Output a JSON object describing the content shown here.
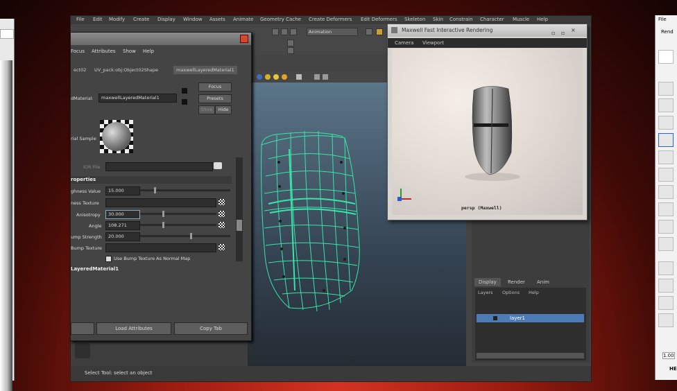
{
  "maya_menu": [
    "File",
    "Edit",
    "Modify",
    "Create",
    "Display",
    "Window",
    "Assets",
    "Animate",
    "Geometry Cache",
    "Create Deformers",
    "Edit Deformers",
    "Skeleton",
    "Skin",
    "Constrain",
    "Character",
    "Muscle",
    "Help"
  ],
  "shelf": {
    "mode": "Animation"
  },
  "attribute_editor": {
    "menu": [
      "Focus",
      "Attributes",
      "Show",
      "Help"
    ],
    "tabs": [
      "ect02",
      "UV_pack:obj:Object02Shape",
      "maxwellLayeredMaterial1"
    ],
    "material_label": "dMaterial:",
    "material_value": "maxwellLayeredMaterial1",
    "buttons": {
      "focus": "Focus",
      "presets": "Presets",
      "show": "Show",
      "hide": "Hide"
    },
    "sample_label": "rial Sample",
    "ior_file_label": "IOR File",
    "section_properties": "roperties",
    "attrs": [
      {
        "label": "ghness Value",
        "value": "15.000"
      },
      {
        "label": "ness Texture",
        "value": ""
      },
      {
        "label": "Anisotropy",
        "value": "30.000"
      },
      {
        "label": "Angle",
        "value": "108.271"
      },
      {
        "label": "ump Strength",
        "value": "20.000"
      },
      {
        "label": "Bump Texture",
        "value": ""
      }
    ],
    "checkbox_label": "Use Bump Texture As Normal Map",
    "section_layered": "LayeredMaterial1",
    "bottom_buttons": [
      "",
      "Load Attributes",
      "Copy Tab"
    ]
  },
  "maxwell": {
    "title": "Maxwell Fast Interactive Rendering",
    "menu": [
      "Camera",
      "Viewport"
    ],
    "caption": "persp (Maxwell)"
  },
  "layers": {
    "tabs": [
      "Display",
      "Render",
      "Anim"
    ],
    "menu": [
      "Layers",
      "Options",
      "Help"
    ],
    "row": "layer1"
  },
  "status": {
    "text": "Select Tool: select an object"
  },
  "right_window": {
    "title": "File",
    "tab": "Rend",
    "value": "1.00",
    "label": "HE"
  }
}
